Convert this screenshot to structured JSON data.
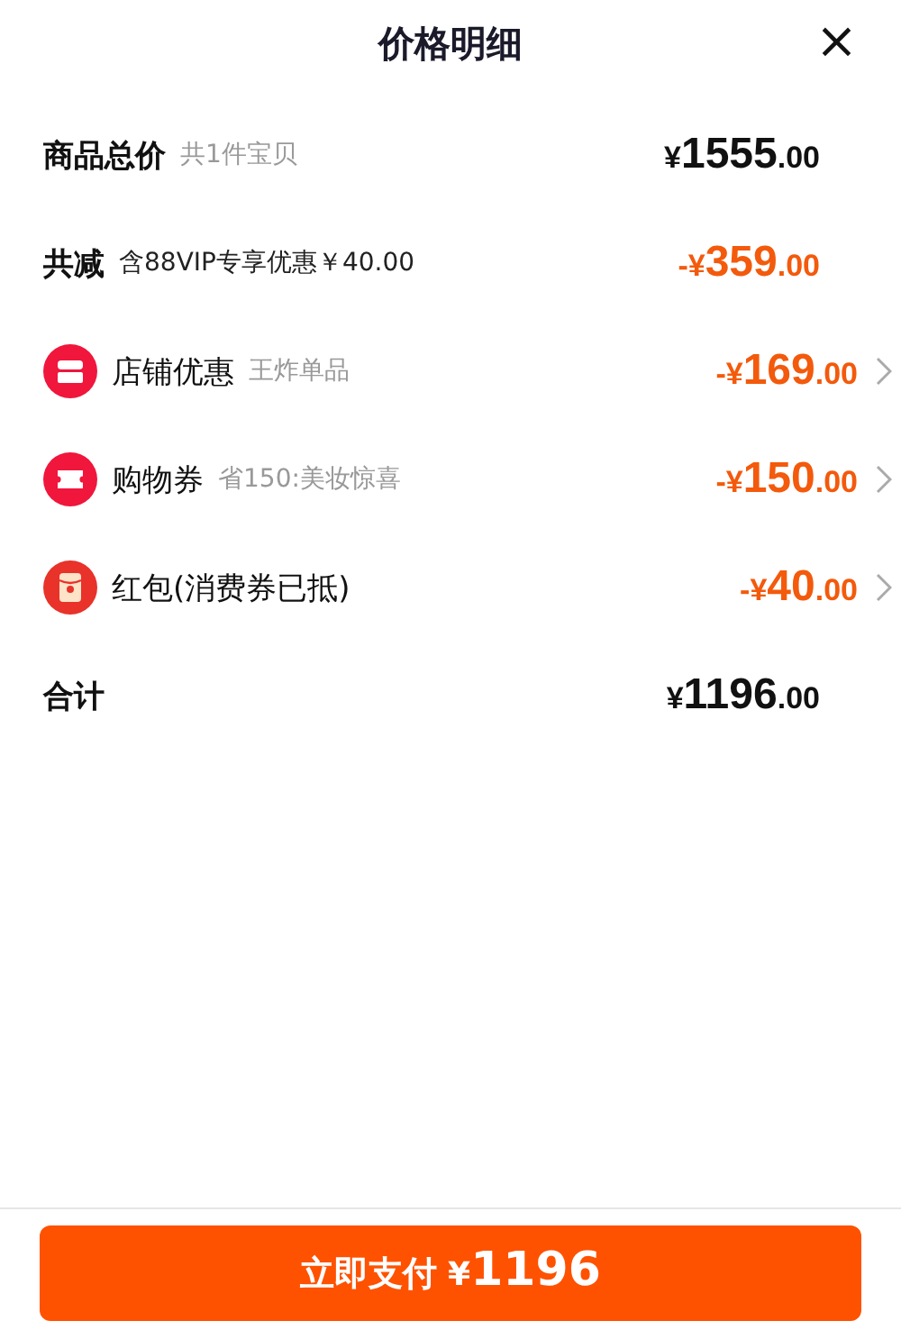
{
  "header": {
    "title": "价格明细",
    "close": "×"
  },
  "rows": [
    {
      "kind": "total",
      "label": "商品总价",
      "note": "共1件宝贝",
      "amount": {
        "prefix": "¥",
        "value": "1555",
        "cents": ".00"
      }
    },
    {
      "kind": "reduction",
      "label": "共减",
      "note": "含88VIP专享优惠￥40.00",
      "amount": {
        "prefix": "-¥",
        "value": "359",
        "cents": ".00"
      }
    },
    {
      "kind": "discount",
      "label": "店铺优惠",
      "note": "王炸单品",
      "amount": {
        "prefix": "-¥",
        "value": "169",
        "cents": ".00"
      }
    },
    {
      "kind": "discount",
      "label": "购物券",
      "note": "省150:美妆惊喜",
      "amount": {
        "prefix": "-¥",
        "value": "150",
        "cents": ".00"
      }
    },
    {
      "kind": "discount",
      "label": "红包(消费券已抵)",
      "amount": {
        "prefix": "-¥",
        "value": "40",
        "cents": ".00"
      }
    },
    {
      "kind": "total",
      "label": "合计",
      "amount": {
        "prefix": "¥",
        "value": "1196",
        "cents": ".00"
      }
    }
  ],
  "pay_button": {
    "label": "立即支付",
    "prefix": "¥",
    "amount": "1196"
  }
}
